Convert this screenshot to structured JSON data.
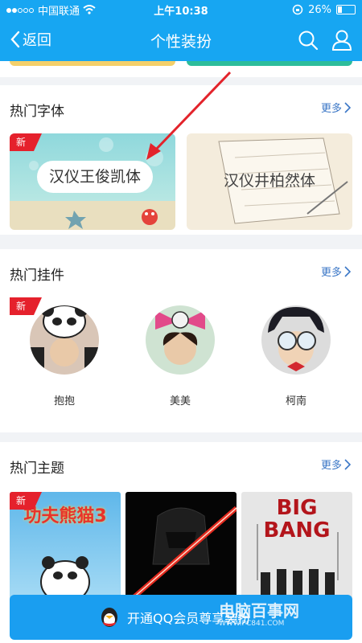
{
  "status": {
    "carrier": "中国联通",
    "time": "上午10:38",
    "battery": "26%",
    "battery_level": 0.26
  },
  "nav": {
    "back": "返回",
    "title": "个性装扮"
  },
  "fonts": {
    "title": "热门字体",
    "more": "更多",
    "badge": "新",
    "items": [
      {
        "text": "汉仪王俊凯体"
      },
      {
        "text": "汉仪井柏然体"
      }
    ]
  },
  "pendants": {
    "title": "热门挂件",
    "more": "更多",
    "badge": "新",
    "items": [
      {
        "name": "抱抱"
      },
      {
        "name": "美美"
      },
      {
        "name": "柯南"
      }
    ]
  },
  "themes": {
    "title": "热门主题",
    "more": "更多",
    "badge": "新",
    "items": [
      {
        "label": "功夫熊猫3"
      },
      {
        "label": ""
      },
      {
        "label": "BIG BANG"
      }
    ]
  },
  "bottom": {
    "text": "开通QQ会员尊享装扮"
  },
  "watermark": {
    "name": "电脑百事网",
    "url": "WWW.PC841.COM"
  }
}
